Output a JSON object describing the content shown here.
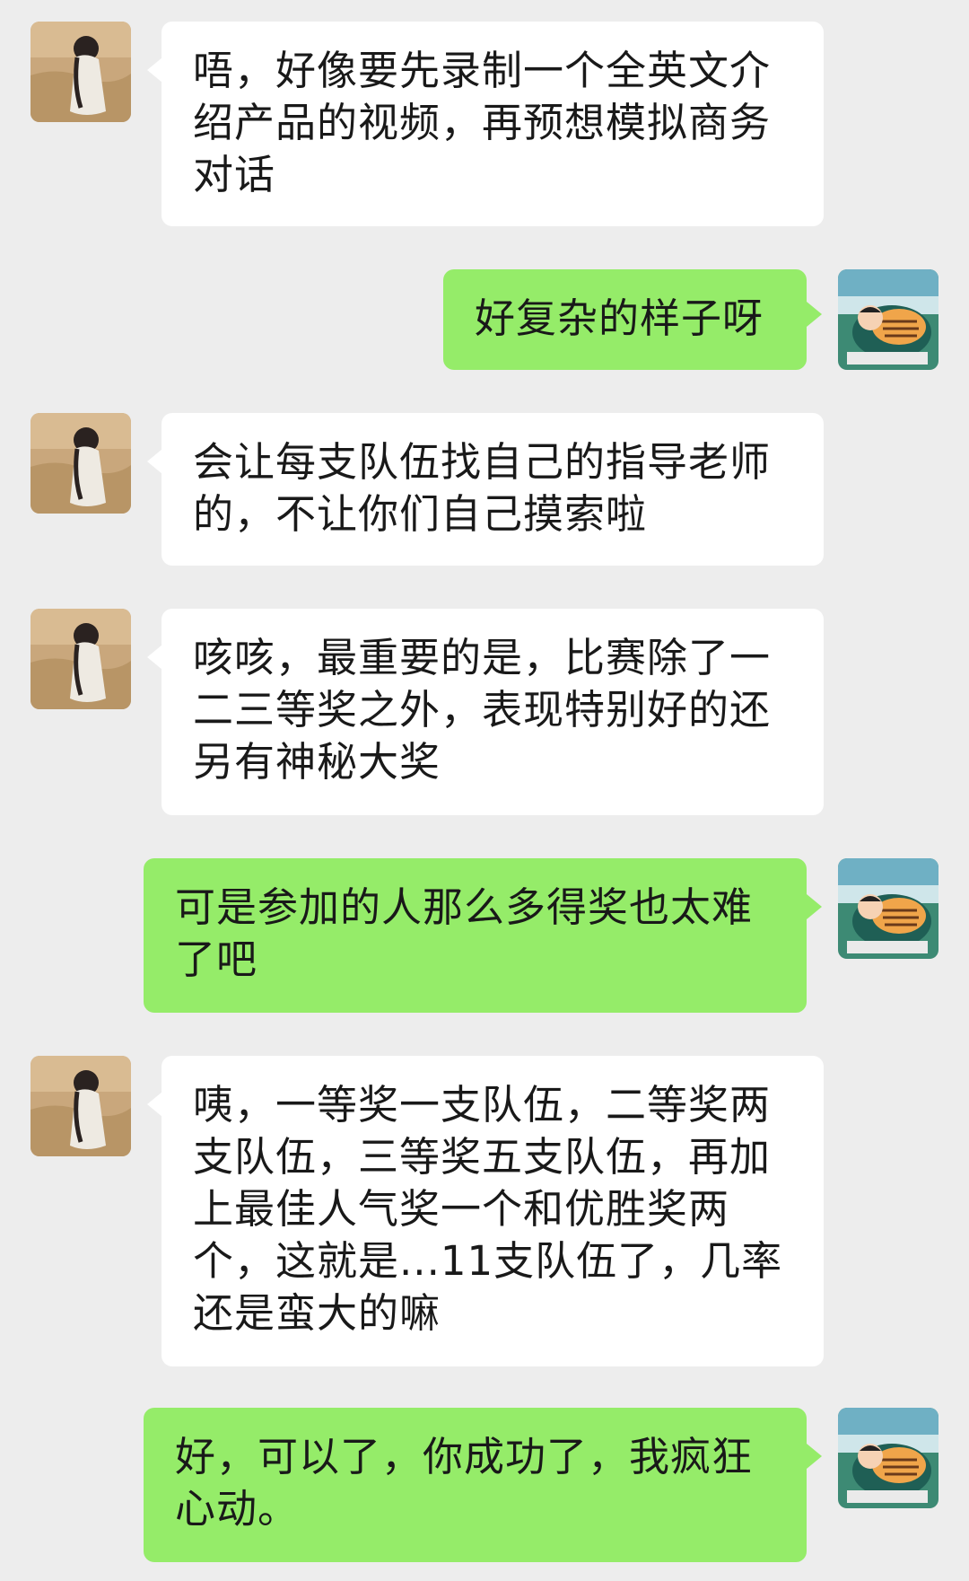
{
  "messages": [
    {
      "side": "left",
      "avatar": "girl-avatar",
      "text": "唔，好像要先录制一个全英文介绍产品的视频，再预想模拟商务对话"
    },
    {
      "side": "right",
      "avatar": "cartoon-boy-avatar",
      "text": "好复杂的样子呀"
    },
    {
      "side": "left",
      "avatar": "girl-avatar",
      "text": "会让每支队伍找自己的指导老师的，不让你们自己摸索啦"
    },
    {
      "side": "left",
      "avatar": "girl-avatar",
      "text": "咳咳，最重要的是，比赛除了一二三等奖之外，表现特别好的还另有神秘大奖"
    },
    {
      "side": "right",
      "avatar": "cartoon-boy-avatar",
      "text": "可是参加的人那么多得奖也太难了吧"
    },
    {
      "side": "left",
      "avatar": "girl-avatar",
      "text": "咦，一等奖一支队伍，二等奖两支队伍，三等奖五支队伍，再加上最佳人气奖一个和优胜奖两个，这就是...11支队伍了，几率还是蛮大的嘛"
    },
    {
      "side": "right",
      "avatar": "cartoon-boy-avatar",
      "text": "好，可以了，你成功了，我疯狂心动。"
    }
  ]
}
